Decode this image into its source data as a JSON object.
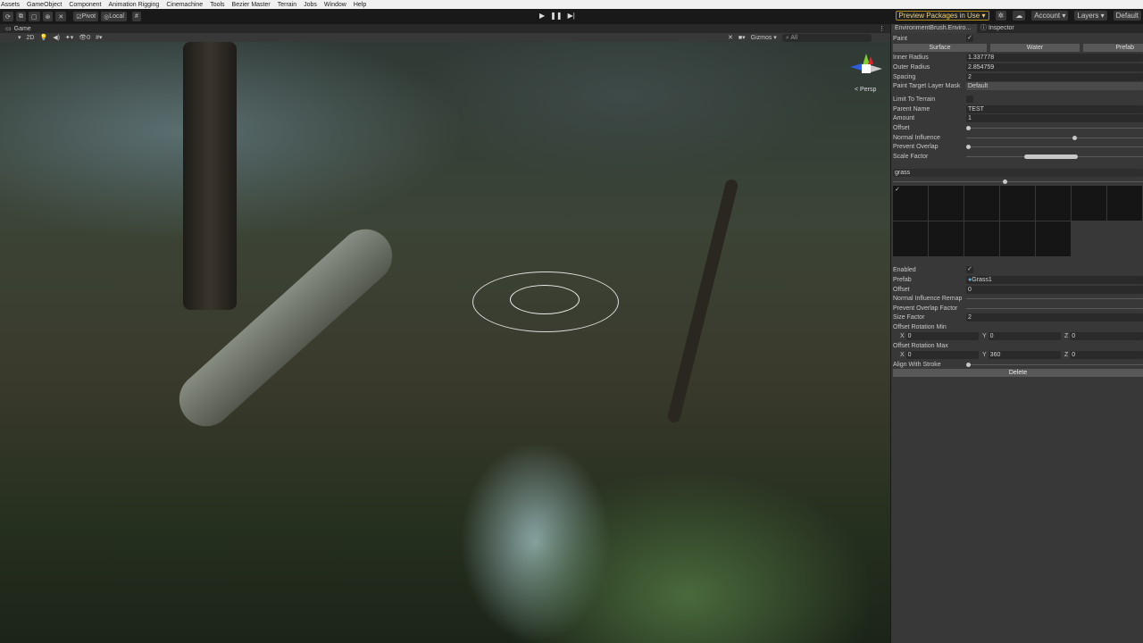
{
  "menu": [
    "Assets",
    "GameObject",
    "Component",
    "Animation Rigging",
    "Cinemachine",
    "Tools",
    "Bezier Master",
    "Terrain",
    "Jobs",
    "Window",
    "Help"
  ],
  "toolbar": {
    "pivot": "Pivot",
    "local": "Local",
    "preview_packages": "Preview Packages in Use",
    "account": "Account",
    "layers": "Layers",
    "layout": "Default"
  },
  "game": {
    "tab": "Game",
    "mode_2d": "2D",
    "gizmos": "Gizmos",
    "search_placeholder": "All",
    "persp": "Persp",
    "stats_count": "0"
  },
  "inspector": {
    "tabs": [
      "EnvironmentBrush.Enviro...",
      "Inspector"
    ],
    "paint_label": "Paint",
    "paint_checked": true,
    "modes": [
      "Surface",
      "Water",
      "Prefab"
    ],
    "inner_radius_label": "Inner Radius",
    "inner_radius": "1.337778",
    "outer_radius_label": "Outer Radius",
    "outer_radius": "2.854759",
    "spacing_label": "Spacing",
    "spacing": "2",
    "layer_mask_label": "Paint Target Layer Mask",
    "layer_mask": "Default",
    "limit_terrain_label": "Limit To Terrain",
    "limit_terrain": false,
    "parent_name_label": "Parent Name",
    "parent_name": "TEST",
    "amount_label": "Amount",
    "amount": "1",
    "offset_label": "Offset",
    "offset_slider": 0,
    "normal_influence_label": "Normal Influence",
    "normal_influence": 0.6,
    "prevent_overlap_label": "Prevent Overlap",
    "prevent_overlap": 0,
    "scale_factor_label": "Scale Factor",
    "scale_factor_range": [
      0.33,
      0.63
    ],
    "group_search": "grass",
    "group_slider": 0.44,
    "item": {
      "enabled_label": "Enabled",
      "enabled": true,
      "prefab_label": "Prefab",
      "prefab": "Grass1",
      "offset_label": "Offset",
      "offset": "0",
      "nir_label": "Normal Influence Remap",
      "pof_label": "Prevent Overlap Factor",
      "size_factor_label": "Size Factor",
      "size_factor": "2",
      "rot_min_label": "Offset Rotation Min",
      "rot_min": {
        "x": "0",
        "y": "0",
        "z": "0"
      },
      "rot_max_label": "Offset Rotation Max",
      "rot_max": {
        "x": "0",
        "y": "360",
        "z": "0"
      },
      "align_label": "Align With Stroke",
      "align": 0
    },
    "delete": "Delete"
  }
}
